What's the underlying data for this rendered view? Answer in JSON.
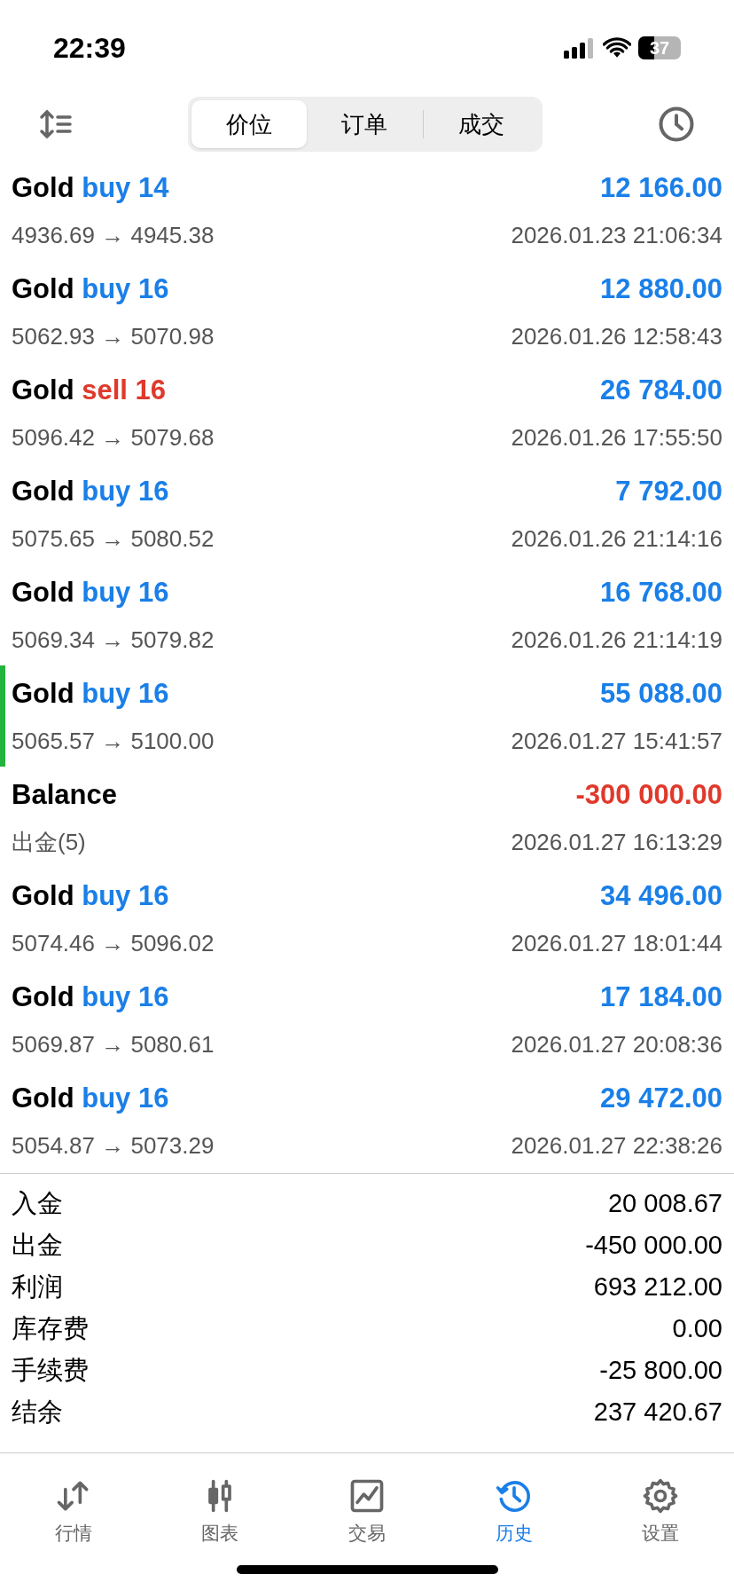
{
  "status_bar": {
    "time": "22:39",
    "battery": "37"
  },
  "segments": [
    {
      "label": "价位",
      "selected": true
    },
    {
      "label": "订单",
      "selected": false
    },
    {
      "label": "成交",
      "selected": false
    }
  ],
  "deals": [
    {
      "kind": "trade",
      "symbol": "Gold",
      "side": "buy",
      "volume": "14",
      "prices": "4936.69 → 4945.38",
      "profit": "12 166.00",
      "negative": false,
      "time": "2026.01.23 21:06:34",
      "marked": false
    },
    {
      "kind": "trade",
      "symbol": "Gold",
      "side": "buy",
      "volume": "16",
      "prices": "5062.93 → 5070.98",
      "profit": "12 880.00",
      "negative": false,
      "time": "2026.01.26 12:58:43",
      "marked": false
    },
    {
      "kind": "trade",
      "symbol": "Gold",
      "side": "sell",
      "volume": "16",
      "prices": "5096.42 → 5079.68",
      "profit": "26 784.00",
      "negative": false,
      "time": "2026.01.26 17:55:50",
      "marked": false
    },
    {
      "kind": "trade",
      "symbol": "Gold",
      "side": "buy",
      "volume": "16",
      "prices": "5075.65 → 5080.52",
      "profit": "7 792.00",
      "negative": false,
      "time": "2026.01.26 21:14:16",
      "marked": false
    },
    {
      "kind": "trade",
      "symbol": "Gold",
      "side": "buy",
      "volume": "16",
      "prices": "5069.34 → 5079.82",
      "profit": "16 768.00",
      "negative": false,
      "time": "2026.01.26 21:14:19",
      "marked": false
    },
    {
      "kind": "trade",
      "symbol": "Gold",
      "side": "buy",
      "volume": "16",
      "prices": "5065.57 → 5100.00",
      "profit": "55 088.00",
      "negative": false,
      "time": "2026.01.27 15:41:57",
      "marked": true
    },
    {
      "kind": "balance",
      "title": "Balance",
      "comment": "出金(5)",
      "profit": "-300 000.00",
      "negative": true,
      "time": "2026.01.27 16:13:29",
      "marked": false
    },
    {
      "kind": "trade",
      "symbol": "Gold",
      "side": "buy",
      "volume": "16",
      "prices": "5074.46 → 5096.02",
      "profit": "34 496.00",
      "negative": false,
      "time": "2026.01.27 18:01:44",
      "marked": false
    },
    {
      "kind": "trade",
      "symbol": "Gold",
      "side": "buy",
      "volume": "16",
      "prices": "5069.87 → 5080.61",
      "profit": "17 184.00",
      "negative": false,
      "time": "2026.01.27 20:08:36",
      "marked": false
    },
    {
      "kind": "trade",
      "symbol": "Gold",
      "side": "buy",
      "volume": "16",
      "prices": "5054.87 → 5073.29",
      "profit": "29 472.00",
      "negative": false,
      "time": "2026.01.27 22:38:26",
      "marked": false
    }
  ],
  "summary": [
    {
      "label": "入金",
      "value": "20 008.67"
    },
    {
      "label": "出金",
      "value": "-450 000.00"
    },
    {
      "label": "利润",
      "value": "693 212.00"
    },
    {
      "label": "库存费",
      "value": "0.00"
    },
    {
      "label": "手续费",
      "value": "-25 800.00"
    },
    {
      "label": "结余",
      "value": "237 420.67"
    }
  ],
  "tabbar": [
    {
      "kind": "quotes",
      "label": "行情",
      "selected": false
    },
    {
      "kind": "chart",
      "label": "图表",
      "selected": false
    },
    {
      "kind": "trade",
      "label": "交易",
      "selected": false
    },
    {
      "kind": "history",
      "label": "历史",
      "selected": true
    },
    {
      "kind": "settings",
      "label": "设置",
      "selected": false
    }
  ]
}
